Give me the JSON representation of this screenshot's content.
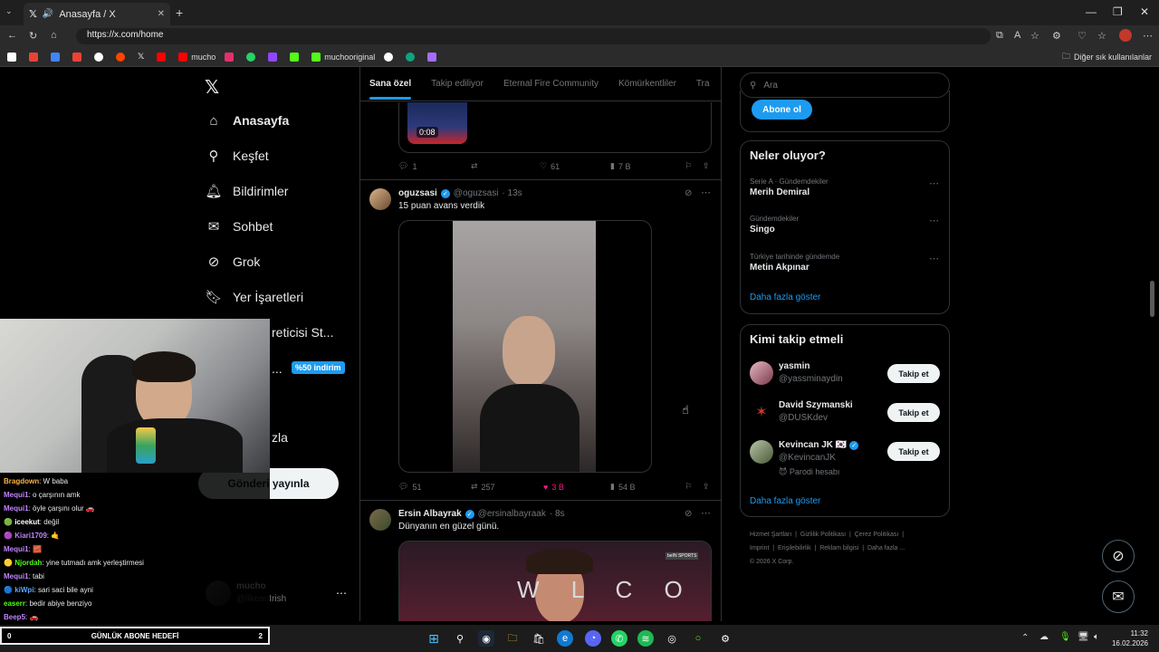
{
  "browser": {
    "tab_title": "Anasayfa / X",
    "url": "https://x.com/home",
    "bookmarks": [
      {
        "label": "",
        "color": "#ffffff"
      },
      {
        "label": "",
        "color": "#ea4335"
      },
      {
        "label": "",
        "color": "#4285f4"
      },
      {
        "label": "",
        "color": "#ea4335"
      },
      {
        "label": "",
        "color": "#ffffff"
      },
      {
        "label": "",
        "color": "#ff4500"
      },
      {
        "label": "",
        "color": "#ffffff"
      },
      {
        "label": "",
        "color": "#ff0000"
      },
      {
        "label": "mucho",
        "color": "#ff0000"
      },
      {
        "label": "",
        "color": "#e1306c"
      },
      {
        "label": "",
        "color": "#25d366"
      },
      {
        "label": "",
        "color": "#9146ff"
      },
      {
        "label": "",
        "color": "#53fc18"
      },
      {
        "label": "muchooriginal",
        "color": "#53fc18"
      },
      {
        "label": "",
        "color": "#ffffff"
      },
      {
        "label": "",
        "color": "#10a37f"
      },
      {
        "label": "",
        "color": "#a66cff"
      }
    ],
    "other_bookmarks": "Diğer sık kullanılanlar"
  },
  "nav": {
    "items": [
      {
        "label": "Anasayfa",
        "icon": "home-icon"
      },
      {
        "label": "Keşfet",
        "icon": "search-icon"
      },
      {
        "label": "Bildirimler",
        "icon": "bell-icon"
      },
      {
        "label": "Sohbet",
        "icon": "mail-icon"
      },
      {
        "label": "Grok",
        "icon": "grok-icon"
      },
      {
        "label": "Yer İşaretleri",
        "icon": "bookmark-icon"
      }
    ],
    "partial_creator": "reticisi St...",
    "partial_more": "zla",
    "discount_badge": "%50 indirim",
    "ellipsis": "...",
    "post_button": "Gönderi yayınla",
    "account": {
      "name": "mucho",
      "handle": "@likeanIrish"
    }
  },
  "feed": {
    "tabs": [
      "Sana özel",
      "Takip ediliyor",
      "Eternal Fire Community",
      "Kömürkentliler",
      "Tra"
    ],
    "tweet0": {
      "duration": "0:08",
      "replies": "1",
      "likes": "61",
      "views": "7 B"
    },
    "tweet1": {
      "name": "oguzsasi",
      "handle": "@oguzsasi",
      "time": "· 13s",
      "text": "15 puan avans verdik",
      "replies": "51",
      "retweets": "257",
      "likes": "3 B",
      "views": "54 B"
    },
    "tweet2": {
      "name": "Ersin Albayrak",
      "handle": "@ersinalbayraak",
      "time": "· 8s",
      "text": "Dünyanın en güzel günü.",
      "overlay_text": "W L C O M",
      "logo": "beIN SPORTS"
    }
  },
  "right": {
    "search_placeholder": "Ara",
    "subscribe_button": "Abone ol",
    "trends_title": "Neler oluyor?",
    "trends": [
      {
        "category": "Serie A · Gündemdekiler",
        "name": "Merih Demiral"
      },
      {
        "category": "Gündemdekiler",
        "name": "Singo"
      },
      {
        "category": "Türkiye tarihinde gündemde",
        "name": "Metin Akpınar"
      }
    ],
    "show_more": "Daha fazla göster",
    "who_title": "Kimi takip etmeli",
    "who": [
      {
        "name": "yasmin",
        "handle": "@yassminaydin",
        "extra": ""
      },
      {
        "name": "David Szymanski",
        "handle": "@DUSKdev",
        "extra": ""
      },
      {
        "name": "Kevincan JK 🇰🇷",
        "handle": "@KevincanJK",
        "extra": "😈 Parodi hesabı"
      }
    ],
    "follow_label": "Takip et",
    "show_more2": "Daha fazla göster",
    "footer": [
      "Hizmet Şartları",
      "Gizlilik Politikası",
      "Çerez Politikası",
      "Imprint",
      "Erişilebilirlik",
      "Reklam bilgisi",
      "Daha fazla ...",
      "© 2026 X Corp."
    ]
  },
  "stream": {
    "chat": [
      {
        "user": "Bragdown",
        "color": "#ffb347",
        "msg": ": W baba"
      },
      {
        "user": "Mequi1",
        "color": "#c084fc",
        "msg": ": o çarşının amk"
      },
      {
        "user": "Mequi1",
        "color": "#c084fc",
        "msg": ": öyle çarşını olur 🚗"
      },
      {
        "user": "iceekut",
        "color": "#ffffff",
        "msg": ": değil"
      },
      {
        "user": "Kiari1709",
        "color": "#c084fc",
        "msg": ": 🤙"
      },
      {
        "user": "Mequi1",
        "color": "#c084fc",
        "msg": ": 🧱"
      },
      {
        "user": "Njordah",
        "color": "#53fc18",
        "msg": ": yine tutmadı amk yerleştirmesi"
      },
      {
        "user": "Mequi1",
        "color": "#c084fc",
        "msg": ": tabi"
      },
      {
        "user": "kiWpi",
        "color": "#60a5fa",
        "msg": ": sari saci bile ayni"
      },
      {
        "user": "easerr",
        "color": "#53fc18",
        "msg": ": bedir abiye benziyo"
      },
      {
        "user": "Beep5",
        "color": "#c084fc",
        "msg": ": 🚗"
      }
    ],
    "goal": {
      "left": "0",
      "label": "GÜNLÜK ABONE HEDEFİ",
      "right": "2"
    }
  },
  "taskbar": {
    "time": "11:32",
    "date": "16.02.2026"
  }
}
